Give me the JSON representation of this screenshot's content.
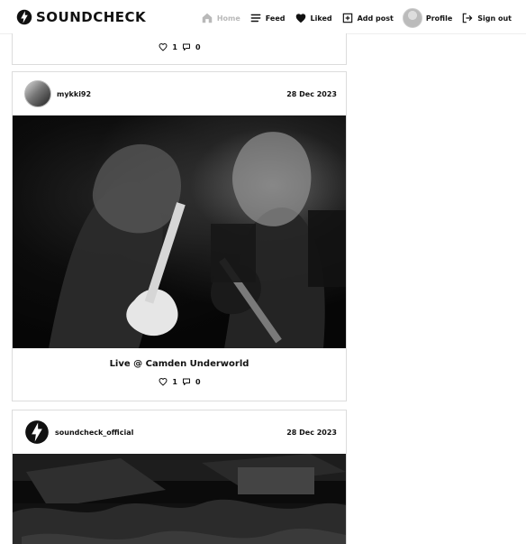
{
  "brand": {
    "name": "SOUNDCHECK"
  },
  "nav": {
    "items": [
      {
        "label": "Home",
        "icon": "home-icon",
        "active": true
      },
      {
        "label": "Feed",
        "icon": "feed-icon",
        "active": false
      },
      {
        "label": "Liked",
        "icon": "heart-icon",
        "active": false
      },
      {
        "label": "Add post",
        "icon": "add-post-icon",
        "active": false
      },
      {
        "label": "Profile",
        "icon": "profile-avatar",
        "active": false
      },
      {
        "label": "Sign out",
        "icon": "sign-out-icon",
        "active": false
      }
    ]
  },
  "posts": [
    {
      "likes": "1",
      "comments": "0"
    },
    {
      "author": "mykki92",
      "date": "28 Dec 2023",
      "caption": "Live @ Camden Underworld",
      "likes": "1",
      "comments": "0"
    },
    {
      "author": "soundcheck_official",
      "date": "28 Dec 2023"
    }
  ],
  "colors": {
    "active_nav": "#b9b9b9",
    "border": "#dcdcdc",
    "text": "#111111"
  }
}
